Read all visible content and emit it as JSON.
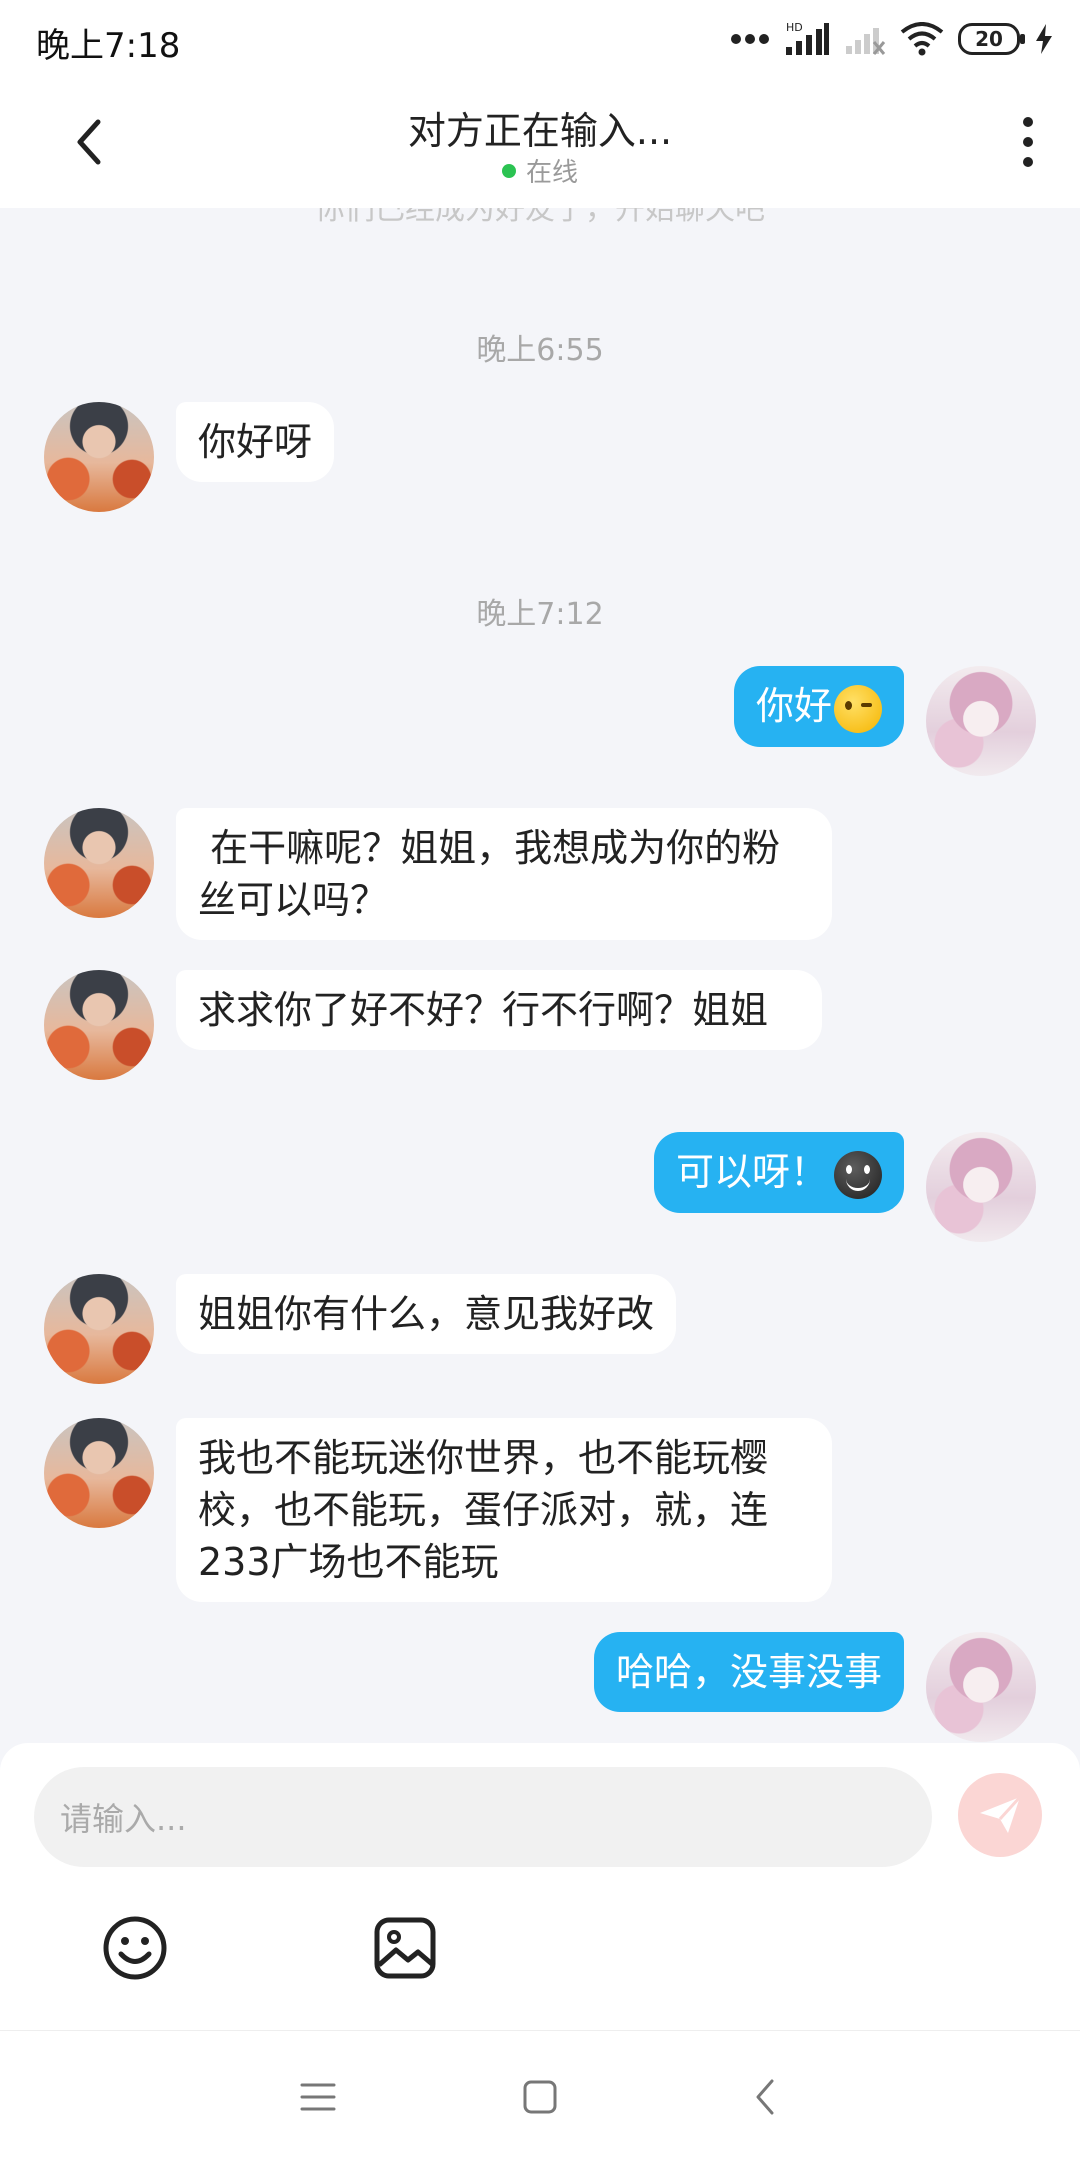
{
  "status_bar": {
    "time": "晚上7:18",
    "battery": "20",
    "icons": [
      "more-dots-icon",
      "signal-hd-icon",
      "signal-off-icon",
      "wifi-icon",
      "battery-icon",
      "charging-icon"
    ]
  },
  "header": {
    "title": "对方正在输入...",
    "status": "在线",
    "back_icon": "chevron-left-icon",
    "more_icon": "more-vertical-icon",
    "online_color": "#2bc352"
  },
  "chat": {
    "system_note": "你们已经成为好友了，开始聊天吧",
    "separators": [
      "晚上6:55",
      "晚上7:12"
    ],
    "messages": [
      {
        "side": "in",
        "text": "你好呀"
      },
      {
        "side": "out",
        "text": "你好",
        "emoji": "winking-face-emoji"
      },
      {
        "side": "in",
        "text": " 在干嘛呢？姐姐，我想成为你的粉丝可以吗？"
      },
      {
        "side": "in",
        "text": "求求你了好不好？行不行啊？姐姐"
      },
      {
        "side": "out",
        "text": "可以呀！",
        "emoji": "dark-smiley-emoji"
      },
      {
        "side": "in",
        "text": "姐姐你有什么，意见我好改"
      },
      {
        "side": "in",
        "text": "我也不能玩迷你世界，也不能玩樱校，也不能玩，蛋仔派对，就，连233广场也不能玩"
      },
      {
        "side": "out",
        "text": "哈哈，没事没事"
      }
    ],
    "outgoing_color": "#26b2f2",
    "incoming_color": "#ffffff"
  },
  "composer": {
    "placeholder": "请输入...",
    "send_icon": "paper-plane-icon",
    "tools": [
      "emoji-icon",
      "image-icon"
    ]
  },
  "nav_bar": {
    "buttons": [
      "menu-icon",
      "home-square-icon",
      "back-triangle-icon"
    ]
  }
}
